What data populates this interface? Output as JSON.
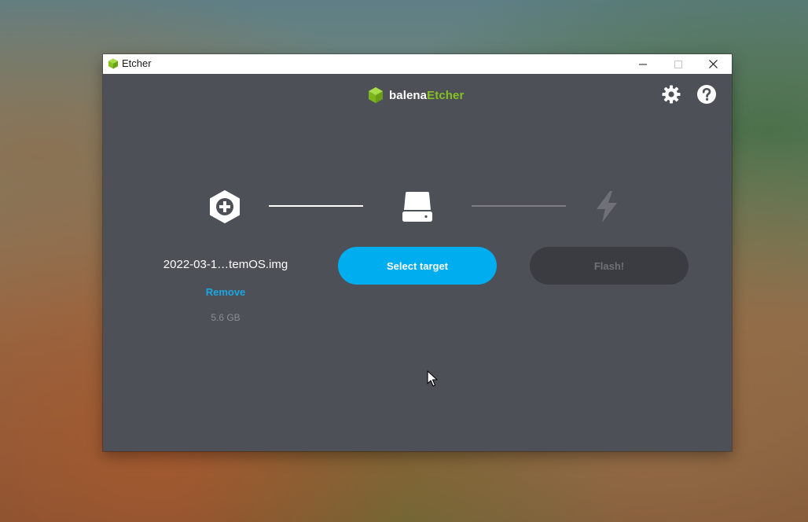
{
  "window": {
    "title": "Etcher",
    "controls": [
      "minimize",
      "maximize",
      "close"
    ]
  },
  "header": {
    "logo_part1": "balena",
    "logo_part2": "Etcher",
    "icons": [
      "gear-icon",
      "help-icon"
    ]
  },
  "steps": {
    "source": {
      "icon": "plus-hexagon-icon",
      "image_name": "2022-03-1…temOS.img",
      "remove_label": "Remove",
      "size": "5.6 GB"
    },
    "target": {
      "icon": "drive-icon",
      "button_label": "Select target"
    },
    "flash": {
      "icon": "lightning-icon",
      "button_label": "Flash!"
    }
  },
  "colors": {
    "background": "#4d5057",
    "accent": "#00aeef",
    "brand_green": "#85c220",
    "link": "#1aa6e2",
    "disabled": "#3a3c41"
  }
}
